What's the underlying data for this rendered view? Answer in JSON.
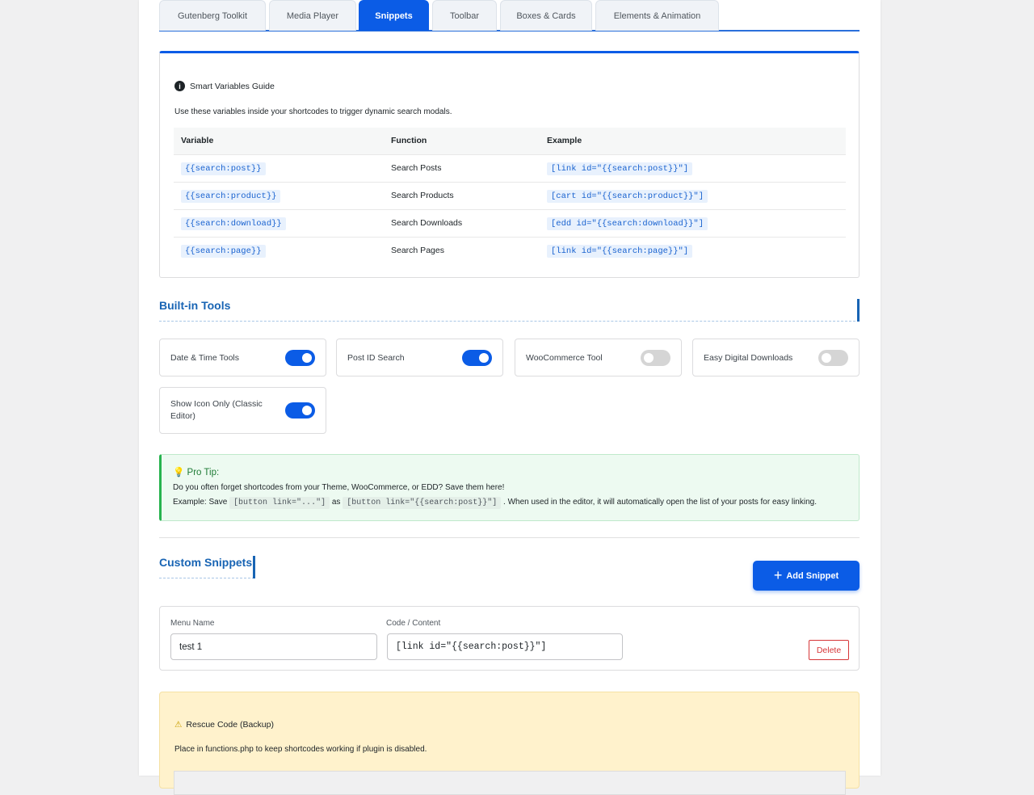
{
  "tabs": [
    "Gutenberg Toolkit",
    "Media Player",
    "Snippets",
    "Toolbar",
    "Boxes & Cards",
    "Elements & Animation"
  ],
  "active_tab": "Snippets",
  "guide": {
    "title": "Smart Variables Guide",
    "desc": "Use these variables inside your shortcodes to trigger dynamic search modals.",
    "headers": [
      "Variable",
      "Function",
      "Example"
    ],
    "rows": [
      {
        "variable": "{{search:post}}",
        "function": "Search Posts",
        "example": "[link id=\"{{search:post}}\"]"
      },
      {
        "variable": "{{search:product}}",
        "function": "Search Products",
        "example": "[cart id=\"{{search:product}}\"]"
      },
      {
        "variable": "{{search:download}}",
        "function": "Search Downloads",
        "example": "[edd id=\"{{search:download}}\"]"
      },
      {
        "variable": "{{search:page}}",
        "function": "Search Pages",
        "example": "[link id=\"{{search:page}}\"]"
      }
    ]
  },
  "builtin": {
    "title": "Built-in Tools",
    "tools": [
      {
        "label": "Date & Time Tools",
        "on": true
      },
      {
        "label": "Post ID Search",
        "on": true
      },
      {
        "label": "WooCommerce Tool",
        "on": false
      },
      {
        "label": "Easy Digital Downloads",
        "on": false
      },
      {
        "label": "Show Icon Only (Classic Editor)",
        "on": true
      }
    ]
  },
  "tip": {
    "title": "Pro Tip:",
    "line1": "Do you often forget shortcodes from your Theme, WooCommerce, or EDD? Save them here!",
    "ex_prefix": "Example: Save",
    "code1": "[button link=\"...\"]",
    "as": "as",
    "code2": "[button link=\"{{search:post}}\"]",
    "ex_suffix": ". When used in the editor, it will automatically open the list of your posts for easy linking."
  },
  "snippets": {
    "title": "Custom Snippets",
    "add_label": "Add Snippet",
    "menu_label": "Menu Name",
    "code_label": "Code / Content",
    "menu_value": "test 1",
    "code_value": "[link id=\"{{search:post}}\"]",
    "delete_label": "Delete"
  },
  "rescue": {
    "title": "Rescue Code (Backup)",
    "desc": "Place in functions.php to keep shortcodes working if plugin is disabled."
  }
}
